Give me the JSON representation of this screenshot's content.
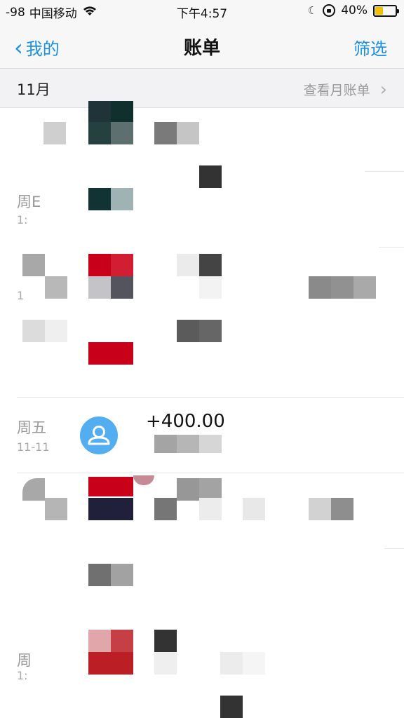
{
  "status_bar": {
    "signal": "-98",
    "carrier": "中国移动",
    "time": "下午4:57",
    "battery_percent": "40%",
    "battery_level": 0.4,
    "icons": [
      "wifi-icon",
      "moon-icon",
      "orientation-lock-icon",
      "battery-icon"
    ]
  },
  "nav": {
    "back_label": "我的",
    "title": "账单",
    "filter_label": "筛选"
  },
  "month_header": {
    "month": "11月",
    "view_month_bill": "查看月账单"
  },
  "transactions": [
    {
      "day": "周五",
      "date": "11-11",
      "amount": "+400.00",
      "icon": "person-avatar-icon"
    }
  ],
  "partial_labels": {
    "day_1": "周E",
    "date_1": "1:",
    "date_2": "1",
    "day_3": "周",
    "date_3": "1:"
  },
  "colors": {
    "accent": "#1a8fe3",
    "avatar": "#52aef0",
    "battery": "#f2c000"
  }
}
